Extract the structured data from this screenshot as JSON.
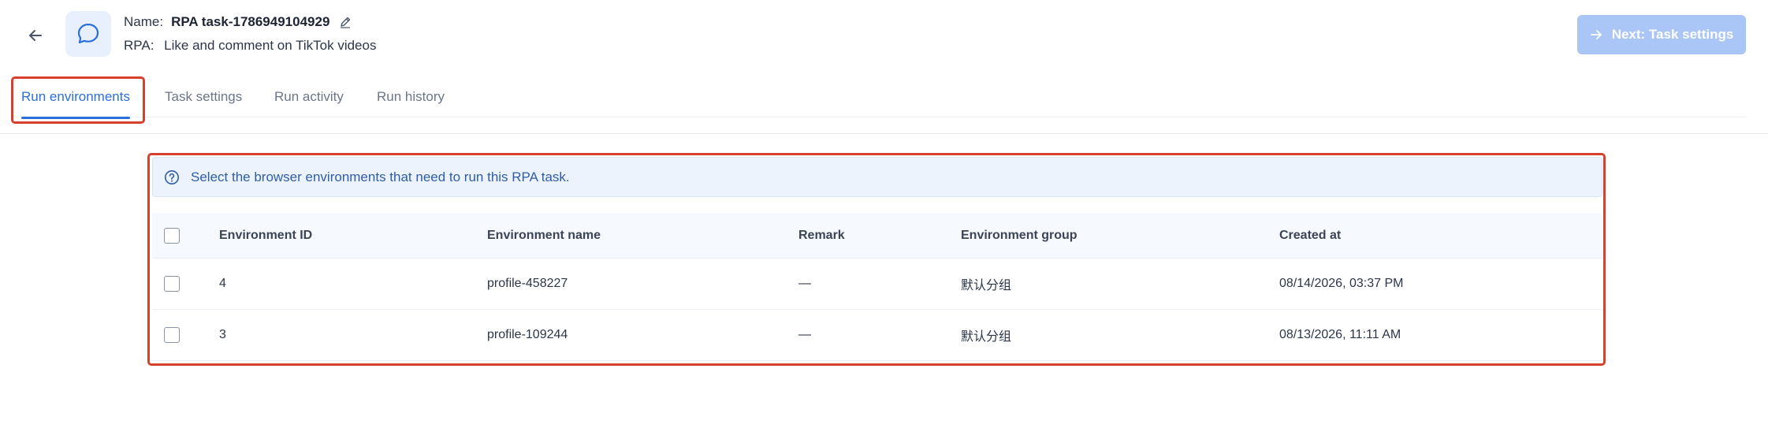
{
  "header": {
    "name_label": "Name:",
    "name_value": "RPA task-1786949104929",
    "rpa_label": "RPA:",
    "rpa_value": "Like and comment on TikTok videos",
    "next_button": "Next: Task settings"
  },
  "tabs": [
    {
      "label": "Run environments",
      "active": true
    },
    {
      "label": "Task settings",
      "active": false
    },
    {
      "label": "Run activity",
      "active": false
    },
    {
      "label": "Run history",
      "active": false
    }
  ],
  "info": {
    "text": "Select the browser environments that need to run this RPA task."
  },
  "table": {
    "columns": [
      "Environment ID",
      "Environment name",
      "Remark",
      "Environment group",
      "Created at"
    ],
    "rows": [
      {
        "id": "4",
        "name": "profile-458227",
        "remark": "—",
        "group": "默认分组",
        "created": "08/14/2026, 03:37 PM"
      },
      {
        "id": "3",
        "name": "profile-109244",
        "remark": "—",
        "group": "默认分组",
        "created": "08/13/2026, 11:11 AM"
      }
    ]
  },
  "colors": {
    "accent": "#2a6fdb",
    "highlight": "#d5412e",
    "next_button_bg": "#a9c6f6",
    "info_bg": "#edf3fc"
  }
}
